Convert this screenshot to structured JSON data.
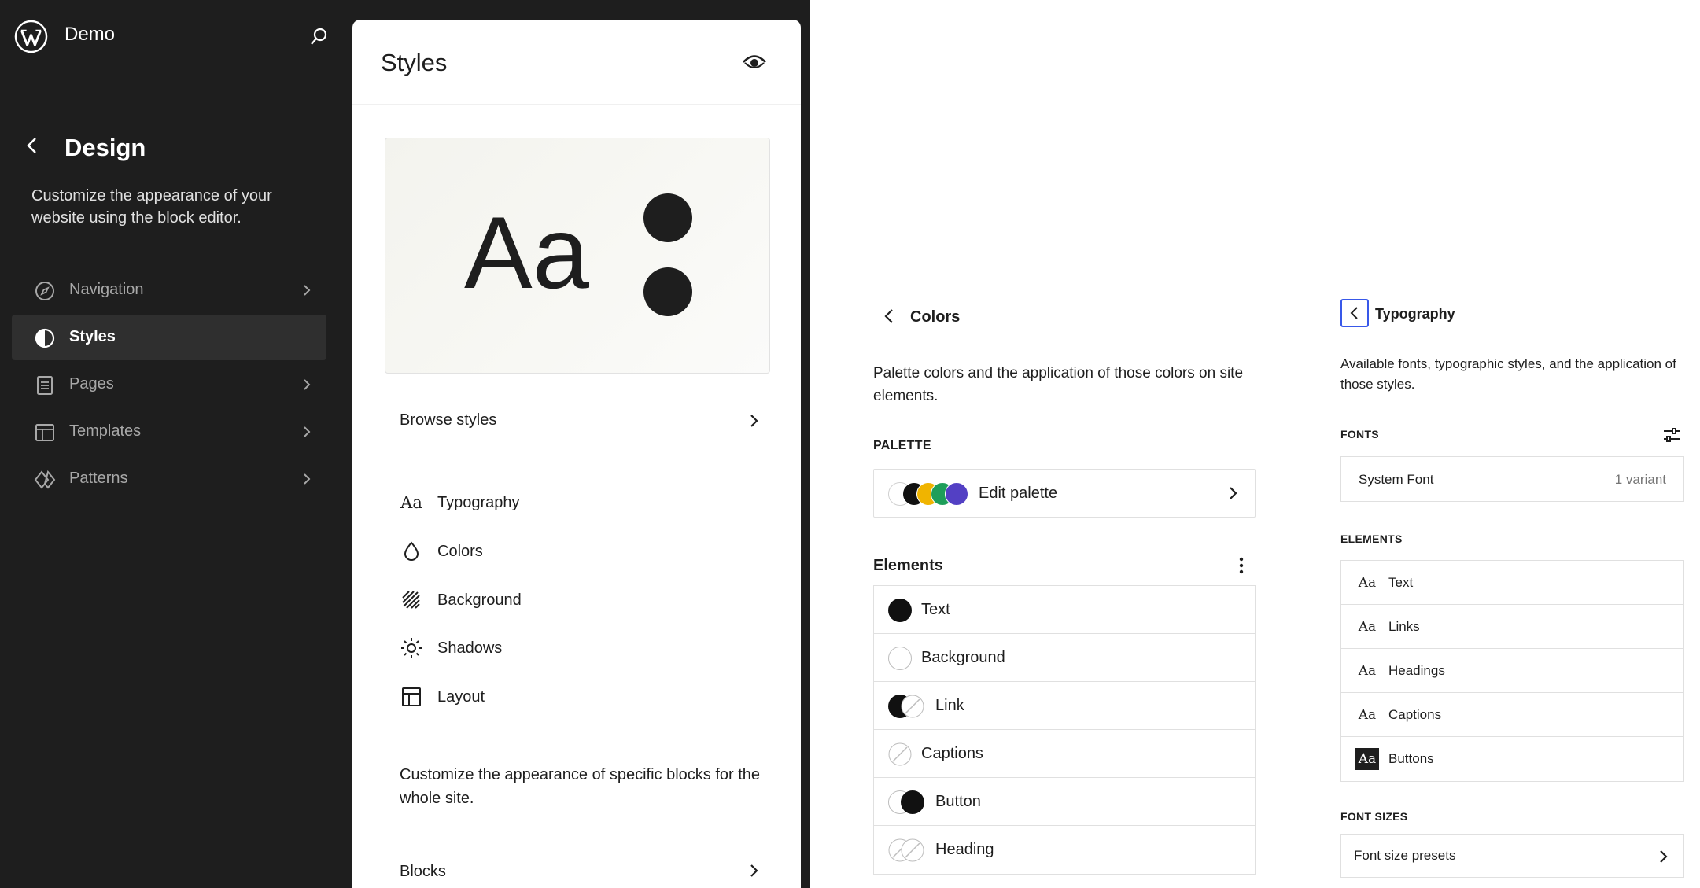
{
  "sidebar": {
    "site_title": "Demo",
    "title": "Design",
    "description": "Customize the appearance of your website using the block editor.",
    "items": [
      {
        "label": "Navigation"
      },
      {
        "label": "Styles"
      },
      {
        "label": "Pages"
      },
      {
        "label": "Templates"
      },
      {
        "label": "Patterns"
      }
    ]
  },
  "styles_panel": {
    "title": "Styles",
    "preview_text": "Aa",
    "browse_label": "Browse styles",
    "items": [
      {
        "label": "Typography"
      },
      {
        "label": "Colors"
      },
      {
        "label": "Background"
      },
      {
        "label": "Shadows"
      },
      {
        "label": "Layout"
      }
    ],
    "blocks_description": "Customize the appearance of specific blocks for the whole site.",
    "blocks_label": "Blocks"
  },
  "colors_panel": {
    "title": "Colors",
    "description": "Palette colors and the application of those colors on site elements.",
    "palette_heading": "PALETTE",
    "palette_label": "Edit palette",
    "palette_colors": [
      "#ffffff",
      "#111111",
      "#f0b400",
      "#1e9e5a",
      "#5340c4"
    ],
    "elements_heading": "Elements",
    "elements": [
      {
        "label": "Text"
      },
      {
        "label": "Background"
      },
      {
        "label": "Link"
      },
      {
        "label": "Captions"
      },
      {
        "label": "Button"
      },
      {
        "label": "Heading"
      }
    ]
  },
  "typography_panel": {
    "title": "Typography",
    "description": "Available fonts, typographic styles, and the application of those styles.",
    "fonts_heading": "FONTS",
    "font_name": "System Font",
    "font_variant": "1 variant",
    "elements_heading": "ELEMENTS",
    "aa_glyph": "Aa",
    "elements": [
      {
        "label": "Text"
      },
      {
        "label": "Links"
      },
      {
        "label": "Headings"
      },
      {
        "label": "Captions"
      },
      {
        "label": "Buttons"
      }
    ],
    "font_sizes_heading": "FONT SIZES",
    "font_sizes_label": "Font size presets"
  },
  "colors": {
    "sidebar_bg": "#1e1e1e",
    "accent": "#3858e9",
    "text": "#1e1e1e"
  }
}
